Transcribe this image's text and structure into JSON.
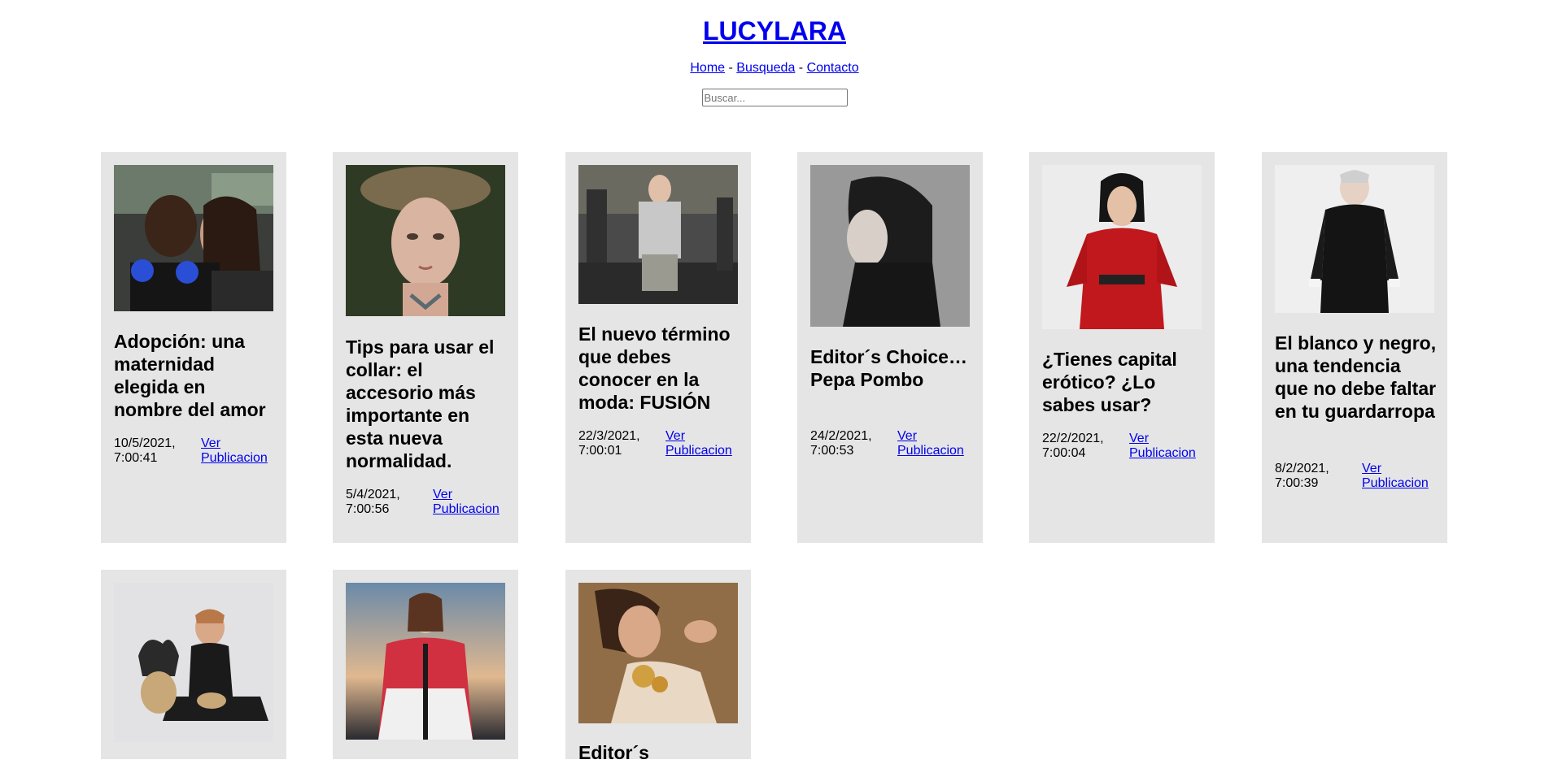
{
  "site": {
    "title": "LUCYLARA",
    "nav": [
      {
        "label": "Home"
      },
      {
        "label": "Busqueda"
      },
      {
        "label": "Contacto"
      }
    ],
    "nav_separator": "-",
    "search_placeholder": "Buscar..."
  },
  "posts": [
    {
      "title": "Adopción: una maternidad elegida en nombre del amor",
      "date": "10/5/2021, 7:00:41",
      "link": "Ver Publicacion"
    },
    {
      "title": "Tips para usar el collar: el accesorio más importante en esta nueva normalidad.",
      "date": "5/4/2021, 7:00:56",
      "link": "Ver Publicacion"
    },
    {
      "title": "El nuevo término que debes conocer en la moda: FUSIÓN",
      "date": "22/3/2021, 7:00:01",
      "link": "Ver Publicacion"
    },
    {
      "title": "Editor´s Choice… Pepa Pombo",
      "date": "24/2/2021, 7:00:53",
      "link": "Ver Publicacion"
    },
    {
      "title": "¿Tienes capital erótico? ¿Lo sabes usar?",
      "date": "22/2/2021, 7:00:04",
      "link": "Ver Publicacion"
    },
    {
      "title": "El blanco y negro, una tendencia que no debe faltar en tu guardarropa",
      "date": "8/2/2021, 7:00:39",
      "link": "Ver Publicacion"
    },
    {
      "title": "",
      "date": "",
      "link": ""
    },
    {
      "title": "",
      "date": "",
      "link": ""
    },
    {
      "title": "Editor´s",
      "date": "",
      "link": ""
    }
  ],
  "colors": {
    "card_bg": "#e5e5e5",
    "link": "#0000ee"
  }
}
